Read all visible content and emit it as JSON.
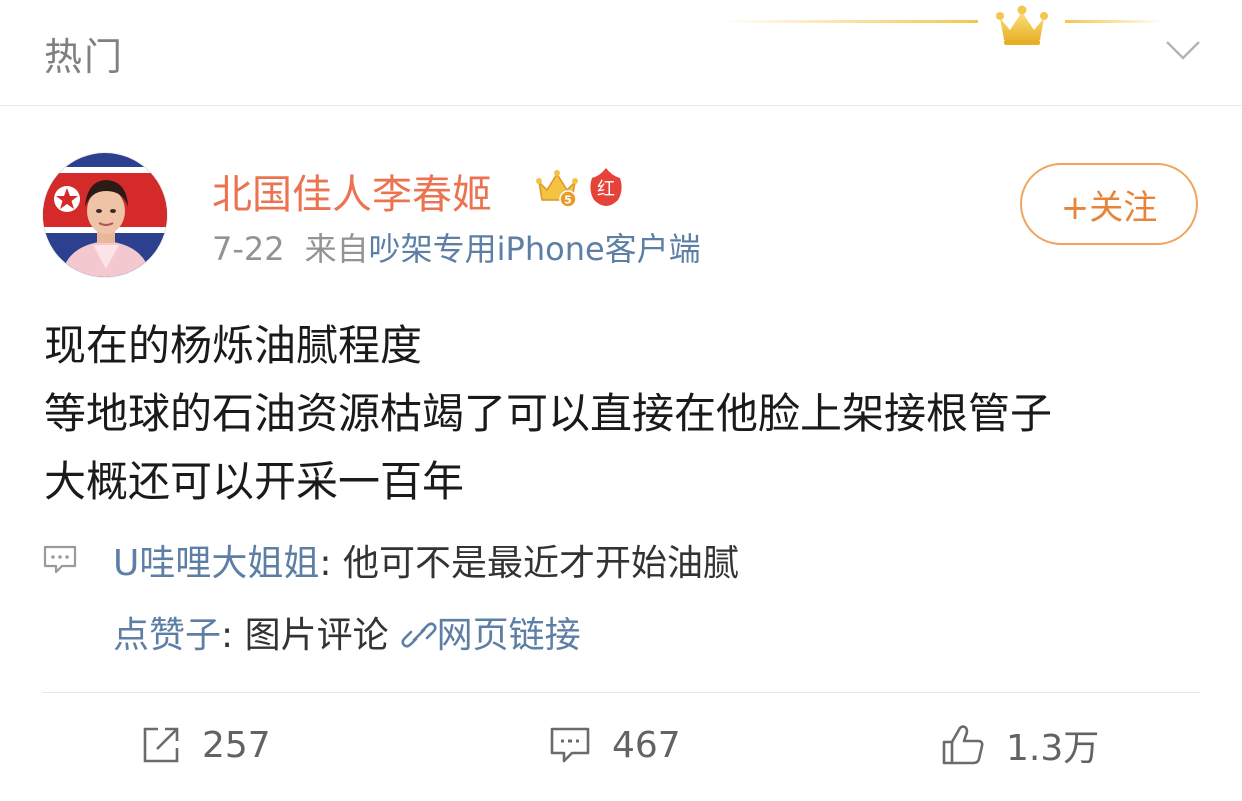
{
  "section": {
    "title": "热门"
  },
  "post": {
    "author": {
      "name": "北国佳人李春姬"
    },
    "date": "7-22",
    "source_label": "来自",
    "source": "吵架专用iPhone客户端",
    "follow_label": "+关注",
    "text_lines": [
      "现在的杨烁油腻程度",
      "等地球的石油资源枯竭了可以直接在他脸上架接根管子",
      "大概还可以开采一百年"
    ]
  },
  "comments": [
    {
      "user": "U哇哩大姐姐",
      "separator": ": ",
      "text": "他可不是最近才开始油腻"
    },
    {
      "user": "点赞子",
      "separator": ": ",
      "text": "图片评论",
      "link_text": "网页链接"
    }
  ],
  "actions": {
    "repost_count": "257",
    "comment_count": "467",
    "like_count": "1.3万"
  },
  "colors": {
    "username": "#eb7350",
    "link": "#5d7fa6",
    "follow": "#e8833a",
    "crown_gold": "#f3c74d"
  },
  "icons": {
    "crown": "crown-icon",
    "collapse": "chevron-down-icon",
    "vip": "vip-crown-badge-icon",
    "red": "red-v-badge-icon",
    "comment_preview": "comment-bubble-icon",
    "link": "link-chain-icon",
    "repost": "repost-icon",
    "comment": "comment-icon",
    "like": "thumbs-up-icon"
  }
}
